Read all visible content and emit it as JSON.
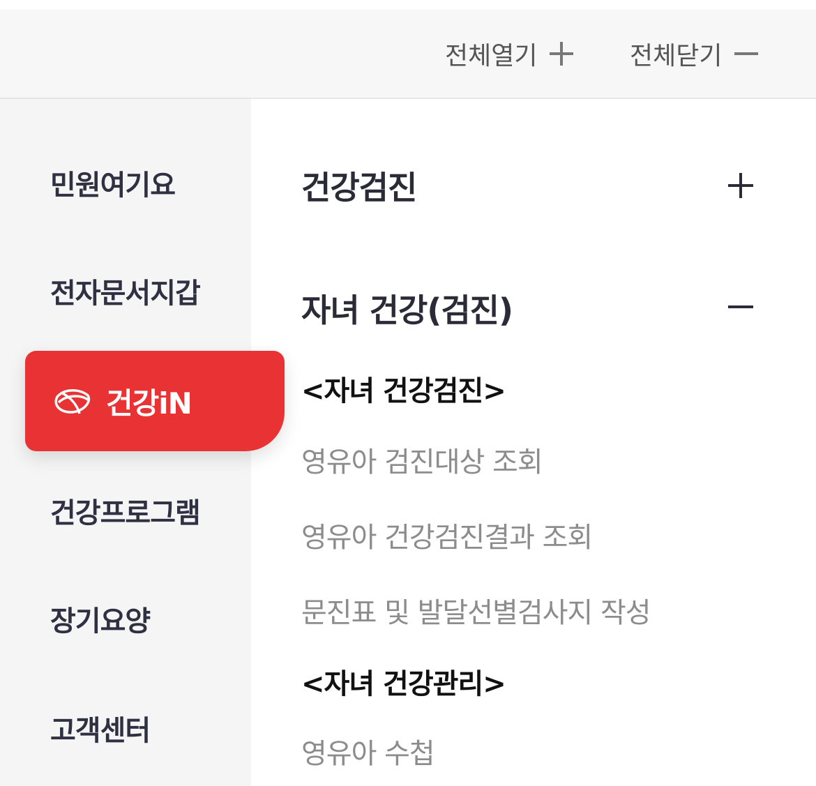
{
  "topbar": {
    "expand_all_label": "전체열기",
    "collapse_all_label": "전체닫기"
  },
  "sidebar": {
    "items": [
      {
        "label": "민원여기요"
      },
      {
        "label": "전자문서지갑"
      },
      {
        "label": "건강iN",
        "active": true,
        "icon": "health-logo-icon"
      },
      {
        "label": "건강프로그램"
      },
      {
        "label": "장기요양"
      },
      {
        "label": "고객센터"
      }
    ],
    "active_color": "#e83234"
  },
  "main": {
    "sections": [
      {
        "title": "건강검진",
        "expanded": false,
        "toggle_icon": "plus-icon"
      },
      {
        "title": "자녀 건강(검진)",
        "expanded": true,
        "toggle_icon": "minus-icon",
        "groups": [
          {
            "heading": "<자녀 건강검진>",
            "links": [
              "영유아 검진대상 조회",
              "영유아 건강검진결과 조회",
              "문진표 및 발달선별검사지 작성"
            ]
          },
          {
            "heading": "<자녀 건강관리>",
            "links": [
              "영유아 수첩"
            ]
          }
        ]
      }
    ]
  }
}
